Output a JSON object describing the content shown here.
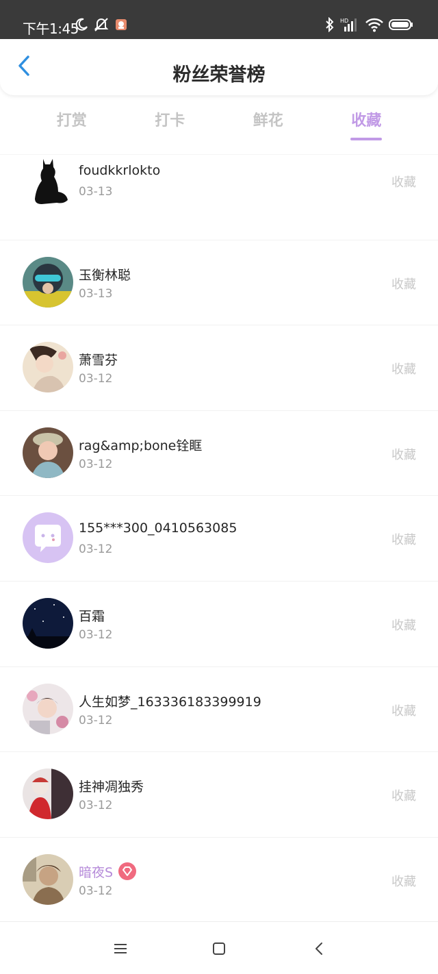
{
  "status_bar": {
    "time": "下午1:45",
    "icons": [
      "moon-icon",
      "bell-off-icon",
      "app-notification-icon",
      "bluetooth-icon",
      "signal-icon",
      "wifi-icon",
      "battery-icon"
    ]
  },
  "header": {
    "title": "粉丝荣誉榜",
    "back_icon": "chevron-left-icon"
  },
  "tabs": [
    {
      "label": "打赏",
      "active": false
    },
    {
      "label": "打卡",
      "active": false
    },
    {
      "label": "鲜花",
      "active": false
    },
    {
      "label": "收藏",
      "active": true
    }
  ],
  "accent_color": "#c19ae6",
  "fans": [
    {
      "name": "foudkkrlokto",
      "date": "03-13",
      "action": "收藏",
      "avatar": "black-cat"
    },
    {
      "name": "玉衡林聪",
      "date": "03-13",
      "action": "收藏",
      "avatar": "helmet"
    },
    {
      "name": "萧雪芬",
      "date": "03-12",
      "action": "收藏",
      "avatar": "portrait-light"
    },
    {
      "name": "rag&amp;bone铨眶",
      "date": "03-12",
      "action": "收藏",
      "avatar": "girl-hat"
    },
    {
      "name": "155***300_0410563085",
      "date": "03-12",
      "action": "收藏",
      "avatar": "default-chat"
    },
    {
      "name": "百霜",
      "date": "03-12",
      "action": "收藏",
      "avatar": "night-sky"
    },
    {
      "name": "人生如梦_163336183399919",
      "date": "03-12",
      "action": "收藏",
      "avatar": "portrait-flowers"
    },
    {
      "name": "挂神凋独秀",
      "date": "03-12",
      "action": "收藏",
      "avatar": "opera"
    },
    {
      "name": "暗夜S",
      "date": "03-12",
      "action": "收藏",
      "avatar": "portrait-vintage",
      "vip": true
    }
  ],
  "nav_bar": {
    "icons": [
      "menu-icon",
      "home-icon",
      "back-icon"
    ]
  }
}
